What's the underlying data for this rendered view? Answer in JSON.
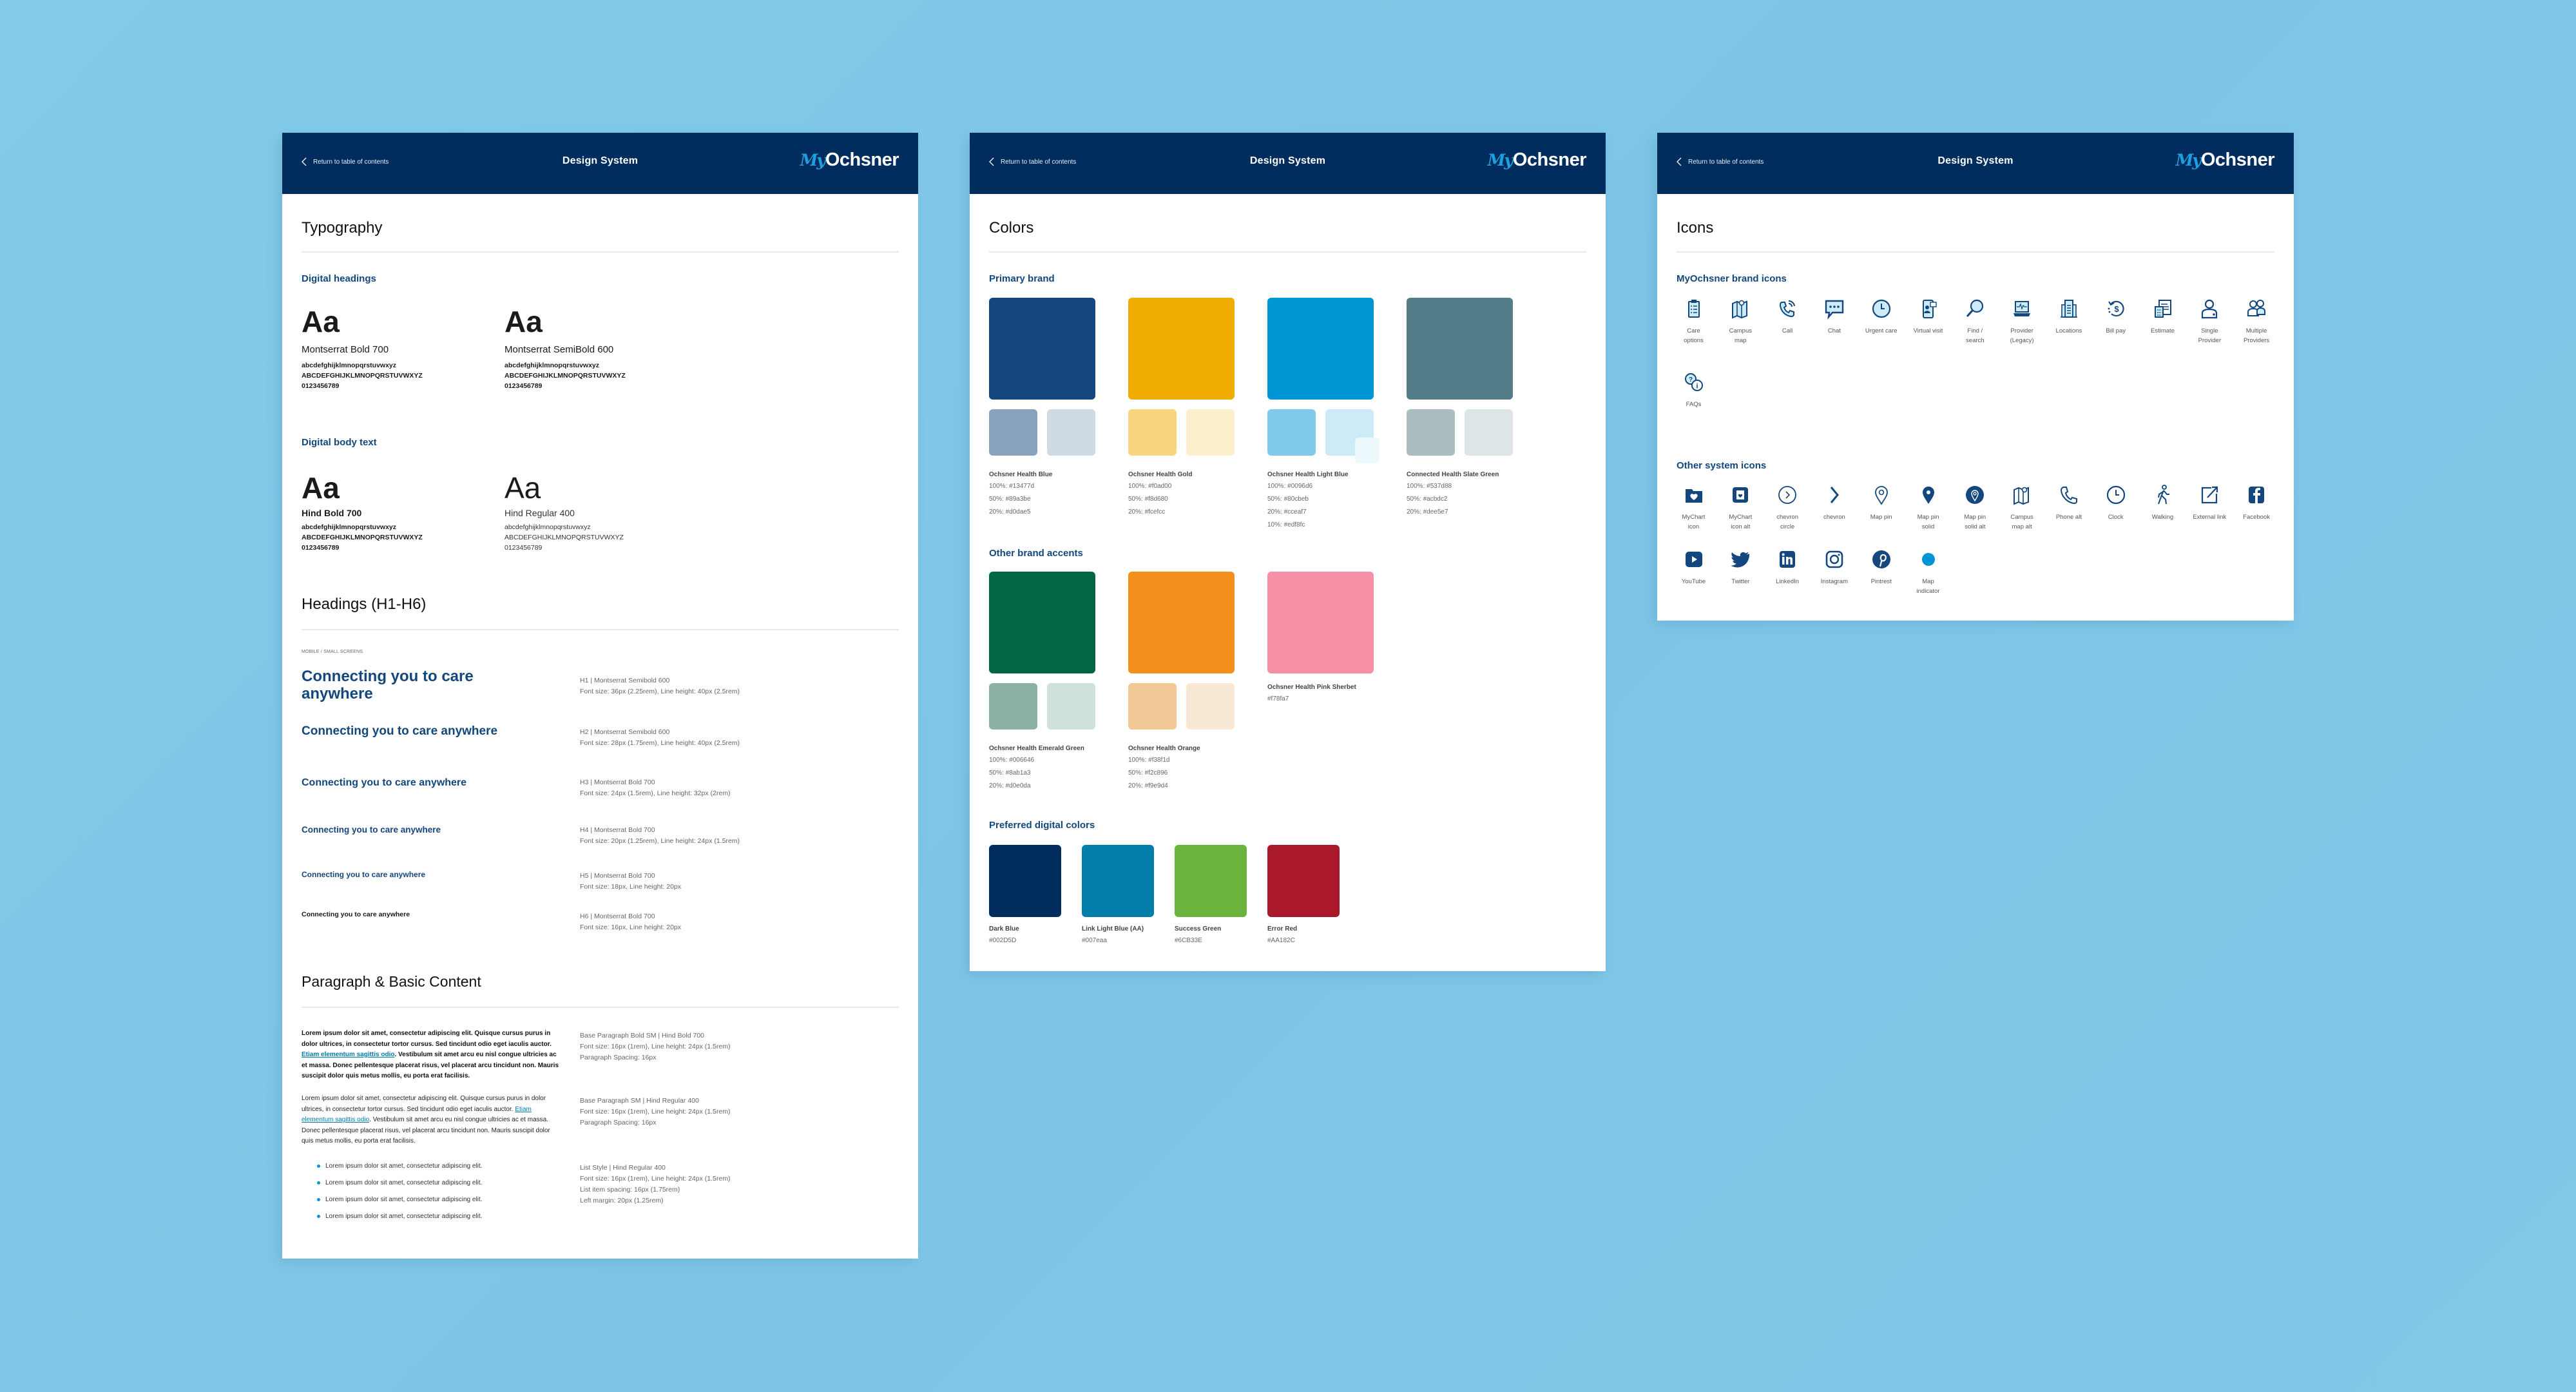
{
  "header": {
    "back_label": "Return to table of contents",
    "title": "Design System",
    "logo_my": "My",
    "logo_brand": "Ochsner"
  },
  "typography": {
    "title": "Typography",
    "digital_headings": {
      "label": "Digital headings",
      "fonts": [
        {
          "sample": "Aa",
          "name": "Montserrat Bold 700",
          "lower": "abcdefghijklmnopqrstuvwxyz",
          "upper": "ABCDEFGHIJKLMNOPQRSTUVWXYZ",
          "digits": "0123456789"
        },
        {
          "sample": "Aa",
          "name": "Montserrat SemiBold 600",
          "lower": "abcdefghijklmnopqrstuvwxyz",
          "upper": "ABCDEFGHIJKLMNOPQRSTUVWXYZ",
          "digits": "0123456789"
        }
      ]
    },
    "digital_body": {
      "label": "Digital body text",
      "fonts": [
        {
          "sample": "Aa",
          "name": "Hind Bold 700",
          "lower": "abcdefghijklmnopqrstuvwxyz",
          "upper": "ABCDEFGHIJKLMNOPQRSTUVWXYZ",
          "digits": "0123456789"
        },
        {
          "sample": "Aa",
          "name": "Hind Regular 400",
          "lower": "abcdefghijklmnopqrstuvwxyz",
          "upper": "ABCDEFGHIJKLMNOPQRSTUVWXYZ",
          "digits": "0123456789"
        }
      ]
    },
    "headings": {
      "title": "Headings (H1-H6)",
      "screen_label": "MOBILE / SMALL SCREENS",
      "items": [
        {
          "sample": "Connecting you to care anywhere",
          "spec": "H1 | Montserrat Semibold 600",
          "size": "Font size: 36px (2.25rem), Line height: 40px (2.5rem)"
        },
        {
          "sample": "Connecting you to care anywhere",
          "spec": "H2 | Montserrat Semibold 600",
          "size": "Font size: 28px (1.75rem), Line height: 40px (2.5rem)"
        },
        {
          "sample": "Connecting you to care anywhere",
          "spec": "H3 | Montserrat Bold 700",
          "size": "Font size: 24px (1.5rem), Line height: 32px (2rem)"
        },
        {
          "sample": "Connecting you to care anywhere",
          "spec": "H4 | Montserrat Bold 700",
          "size": "Font size: 20px (1.25rem), Line height: 24px (1.5rem)"
        },
        {
          "sample": "Connecting you to care anywhere",
          "spec": "H5 | Montserrat Bold 700",
          "size": "Font size: 18px, Line height: 20px"
        },
        {
          "sample": "Connecting you to care anywhere",
          "spec": "H6 | Montserrat Bold 700",
          "size": "Font size: 16px, Line height: 20px"
        }
      ]
    },
    "paragraph": {
      "title": "Paragraph & Basic Content",
      "bold_para": {
        "before": "Lorem ipsum dolor sit amet, consectetur adipiscing elit. Quisque cursus purus in dolor ultrices, in consectetur tortor cursus. Sed tincidunt odio eget iaculis auctor. ",
        "link": "Etiam elementum sagittis odio",
        "after": ". Vestibulum sit amet arcu eu nisl congue ultricies ac et massa. Donec pellentesque placerat risus, vel placerat arcu tincidunt non. Mauris suscipit dolor quis metus mollis, eu porta erat facilisis.",
        "spec": [
          "Base Paragraph Bold SM | Hind Bold 700",
          "Font size: 16px (1rem), Line height: 24px (1.5rem)",
          "Paragraph Spacing: 16px"
        ]
      },
      "regular_para": {
        "before": "Lorem ipsum dolor sit amet, consectetur adipiscing elit. Quisque cursus purus in dolor ultrices, in consectetur tortor cursus. Sed tincidunt odio eget iaculis auctor. ",
        "link": "Etiam elementum sagittis odio",
        "after": ". Vestibulum sit amet arcu eu nisl congue ultricies ac et massa. Donec pellentesque placerat risus, vel placerat arcu tincidunt non. Mauris suscipit dolor quis metus mollis, eu porta erat facilisis.",
        "spec": [
          "Base Paragraph SM | Hind Regular 400",
          "Font size: 16px (1rem), Line height: 24px (1.5rem)",
          "Paragraph Spacing: 16px"
        ]
      },
      "list": {
        "items": [
          "Lorem ipsum dolor sit amet, consectetur adipiscing elit.",
          "Lorem ipsum dolor sit amet, consectetur adipiscing elit.",
          "Lorem ipsum dolor sit amet, consectetur adipiscing elit.",
          "Lorem ipsum dolor sit amet, consectetur adipiscing elit."
        ],
        "spec": [
          "List Style | Hind Regular 400",
          "Font size: 16px (1rem), Line height: 24px (1.5rem)",
          "List item spacing: 16px (1.75rem)",
          "Left margin: 20px (1.25rem)"
        ]
      }
    }
  },
  "colors": {
    "title": "Colors",
    "primary": {
      "label": "Primary brand",
      "items": [
        {
          "name": "Ochsner Health Blue",
          "main": "#13477d",
          "tints": [
            "#89a3be",
            "#d0dae5"
          ],
          "hex": [
            "100%: #13477d",
            "50%: #89a3be",
            "20%: #d0dae5"
          ]
        },
        {
          "name": "Ochsner Health Gold",
          "main": "#f0ad00",
          "tints": [
            "#f8d680",
            "#fcefcc"
          ],
          "hex": [
            "100%: #f0ad00",
            "50%: #f8d680",
            "20%: #fcefcc"
          ]
        },
        {
          "name": "Ochsner Health Light Blue",
          "main": "#0096d6",
          "tints": [
            "#80cbeb",
            "#cceaf7"
          ],
          "extra": "#edf8fc",
          "hex": [
            "100%: #0096d6",
            "50%: #80cbeb",
            "20%: #cceaf7",
            "10%: #edf8fc"
          ]
        },
        {
          "name": "Connected Health Slate Green",
          "main": "#537d88",
          "tints": [
            "#acbdc2",
            "#dee5e7"
          ],
          "hex": [
            "100%: #537d88",
            "50%: #acbdc2",
            "20%: #dee5e7"
          ]
        }
      ]
    },
    "accents": {
      "label": "Other brand accents",
      "items": [
        {
          "name": "Ochsner Health Emerald Green",
          "main": "#006646",
          "tints": [
            "#8ab1a3",
            "#d0e0da"
          ],
          "hex": [
            "100%: #006646",
            "50%: #8ab1a3",
            "20%: #d0e0da"
          ]
        },
        {
          "name": "Ochsner Health Orange",
          "main": "#f38f1d",
          "tints": [
            "#f2c896",
            "#f9e9d4"
          ],
          "hex": [
            "100%: #f38f1d",
            "50%: #f2c896",
            "20%: #f9e9d4"
          ]
        },
        {
          "name": "Ochsner Health Pink Sherbet",
          "main": "#f78fa7",
          "tints": [],
          "hex": [
            "#f78fa7"
          ]
        }
      ]
    },
    "digital": {
      "label": "Preferred digital colors",
      "items": [
        {
          "name": "Dark Blue",
          "main": "#002D5D",
          "hex": "#002D5D"
        },
        {
          "name": "Link Light Blue (AA)",
          "main": "#007eaa",
          "hex": "#007eaa"
        },
        {
          "name": "Success Green",
          "main": "#6CB33E",
          "hex": "#6CB33E"
        },
        {
          "name": "Error Red",
          "main": "#AA182C",
          "hex": "#AA182C"
        }
      ]
    }
  },
  "icons": {
    "title": "Icons",
    "brand": {
      "label": "MyOchsner brand icons",
      "items": [
        {
          "icon": "care-options-icon",
          "label": "Care options"
        },
        {
          "icon": "campus-map-icon",
          "label": "Campus map"
        },
        {
          "icon": "call-icon",
          "label": "Call"
        },
        {
          "icon": "chat-icon",
          "label": "Chat"
        },
        {
          "icon": "urgent-care-icon",
          "label": "Urgent care"
        },
        {
          "icon": "virtual-visit-icon",
          "label": "Virtual visit"
        },
        {
          "icon": "find-search-icon",
          "label": "Find / search"
        },
        {
          "icon": "provider-legacy-icon",
          "label": "Provider (Legacy)"
        },
        {
          "icon": "locations-icon",
          "label": "Locations"
        },
        {
          "icon": "bill-pay-icon",
          "label": "Bill pay"
        },
        {
          "icon": "estimate-icon",
          "label": "Estimate"
        },
        {
          "icon": "single-provider-icon",
          "label": "Single Provider"
        },
        {
          "icon": "multiple-providers-icon",
          "label": "Multiple Providers"
        },
        {
          "icon": "faqs-icon",
          "label": "FAQs"
        }
      ]
    },
    "system": {
      "label": "Other system icons",
      "items": [
        {
          "icon": "mychart-icon",
          "label": "MyChart icon"
        },
        {
          "icon": "mychart-alt-icon",
          "label": "MyChart icon alt"
        },
        {
          "icon": "chevron-circle-icon",
          "label": "chevron circle"
        },
        {
          "icon": "chevron-icon",
          "label": "chevron"
        },
        {
          "icon": "map-pin-icon",
          "label": "Map pin"
        },
        {
          "icon": "map-pin-solid-icon",
          "label": "Map pin solid"
        },
        {
          "icon": "map-pin-solid-alt-icon",
          "label": "Map pin solid alt"
        },
        {
          "icon": "campus-map-alt-icon",
          "label": "Campus map alt"
        },
        {
          "icon": "phone-alt-icon",
          "label": "Phone alt"
        },
        {
          "icon": "clock-icon",
          "label": "Clock"
        },
        {
          "icon": "walking-icon",
          "label": "Walking"
        },
        {
          "icon": "external-link-icon",
          "label": "External link"
        },
        {
          "icon": "facebook-icon",
          "label": "Facebook"
        },
        {
          "icon": "youtube-icon",
          "label": "YouTube"
        },
        {
          "icon": "twitter-icon",
          "label": "Twitter"
        },
        {
          "icon": "linkedin-icon",
          "label": "LinkedIn"
        },
        {
          "icon": "instagram-icon",
          "label": "Instagram"
        },
        {
          "icon": "pinterest-icon",
          "label": "Pintrest"
        },
        {
          "icon": "map-indicator-icon",
          "label": "Map indicator"
        }
      ]
    }
  },
  "palette": {
    "navy": "#002d5d",
    "brand_blue": "#13477d",
    "icon_fill": "#cceaf7",
    "light_blue": "#0096d6",
    "link": "#007eaa"
  }
}
